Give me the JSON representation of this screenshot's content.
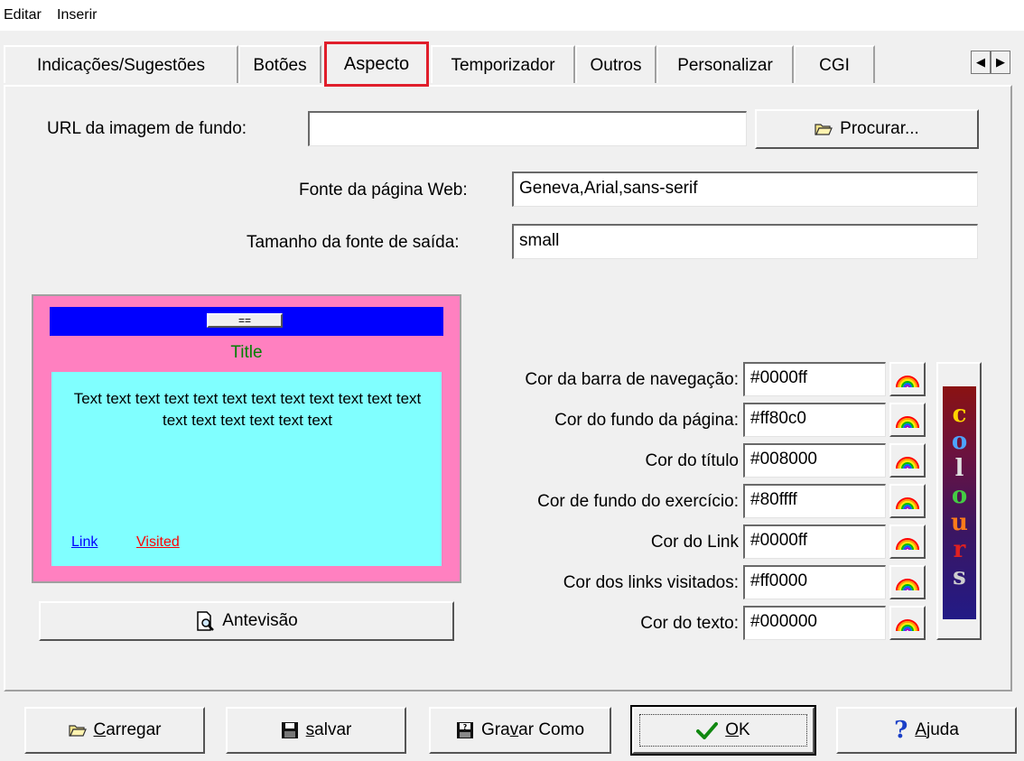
{
  "menu": [
    "Editar",
    "Inserir"
  ],
  "tabs": [
    "Indicações/Sugestões",
    "Botões",
    "Aspecto",
    "Temporizador",
    "Outros",
    "Personalizar",
    "CGI"
  ],
  "selected_tab": "Aspecto",
  "scroll": {
    "left": "◀",
    "right": "▶"
  },
  "fields": {
    "bg_url_label": "URL da imagem de fundo:",
    "bg_url_value": "",
    "browse_label": "Procurar...",
    "font_label": "Fonte da página Web:",
    "font_value": "Geneva,Arial,sans-serif",
    "size_label": "Tamanho da fonte de saída:",
    "size_value": "small"
  },
  "preview": {
    "nav_button": "==",
    "title": "Title",
    "body_text": "Text text text text text text text text text text text text text text text text text text",
    "link": "Link",
    "visited": "Visited",
    "preview_button": "Antevisão"
  },
  "colors": [
    {
      "label": "Cor da barra de navegação:",
      "value": "#0000ff"
    },
    {
      "label": "Cor do fundo da página:",
      "value": "#ff80c0"
    },
    {
      "label": "Cor do título",
      "value": "#008000"
    },
    {
      "label": "Cor de fundo do exercício:",
      "value": "#80ffff"
    },
    {
      "label": "Cor do Link",
      "value": "#0000ff"
    },
    {
      "label": "Cor dos links visitados:",
      "value": "#ff0000"
    },
    {
      "label": "Cor do texto:",
      "value": "#000000"
    }
  ],
  "colours_button": [
    "c",
    "o",
    "l",
    "o",
    "u",
    "r",
    "s"
  ],
  "colours_letter_colors": [
    "#ffd400",
    "#4da3ff",
    "#e0e0e0",
    "#44cc44",
    "#ff7a1a",
    "#e02020",
    "#cfcfcf"
  ],
  "bottom_buttons": {
    "load": {
      "prefix": "",
      "accel": "C",
      "rest": "arregar"
    },
    "save": {
      "prefix": "",
      "accel": "s",
      "rest": "alvar"
    },
    "save_as": {
      "prefix": "Gra",
      "accel": "v",
      "rest": "ar Como"
    },
    "ok": {
      "prefix": "",
      "accel": "O",
      "rest": "K"
    },
    "help": {
      "prefix": "",
      "accel": "A",
      "rest": "juda"
    }
  }
}
